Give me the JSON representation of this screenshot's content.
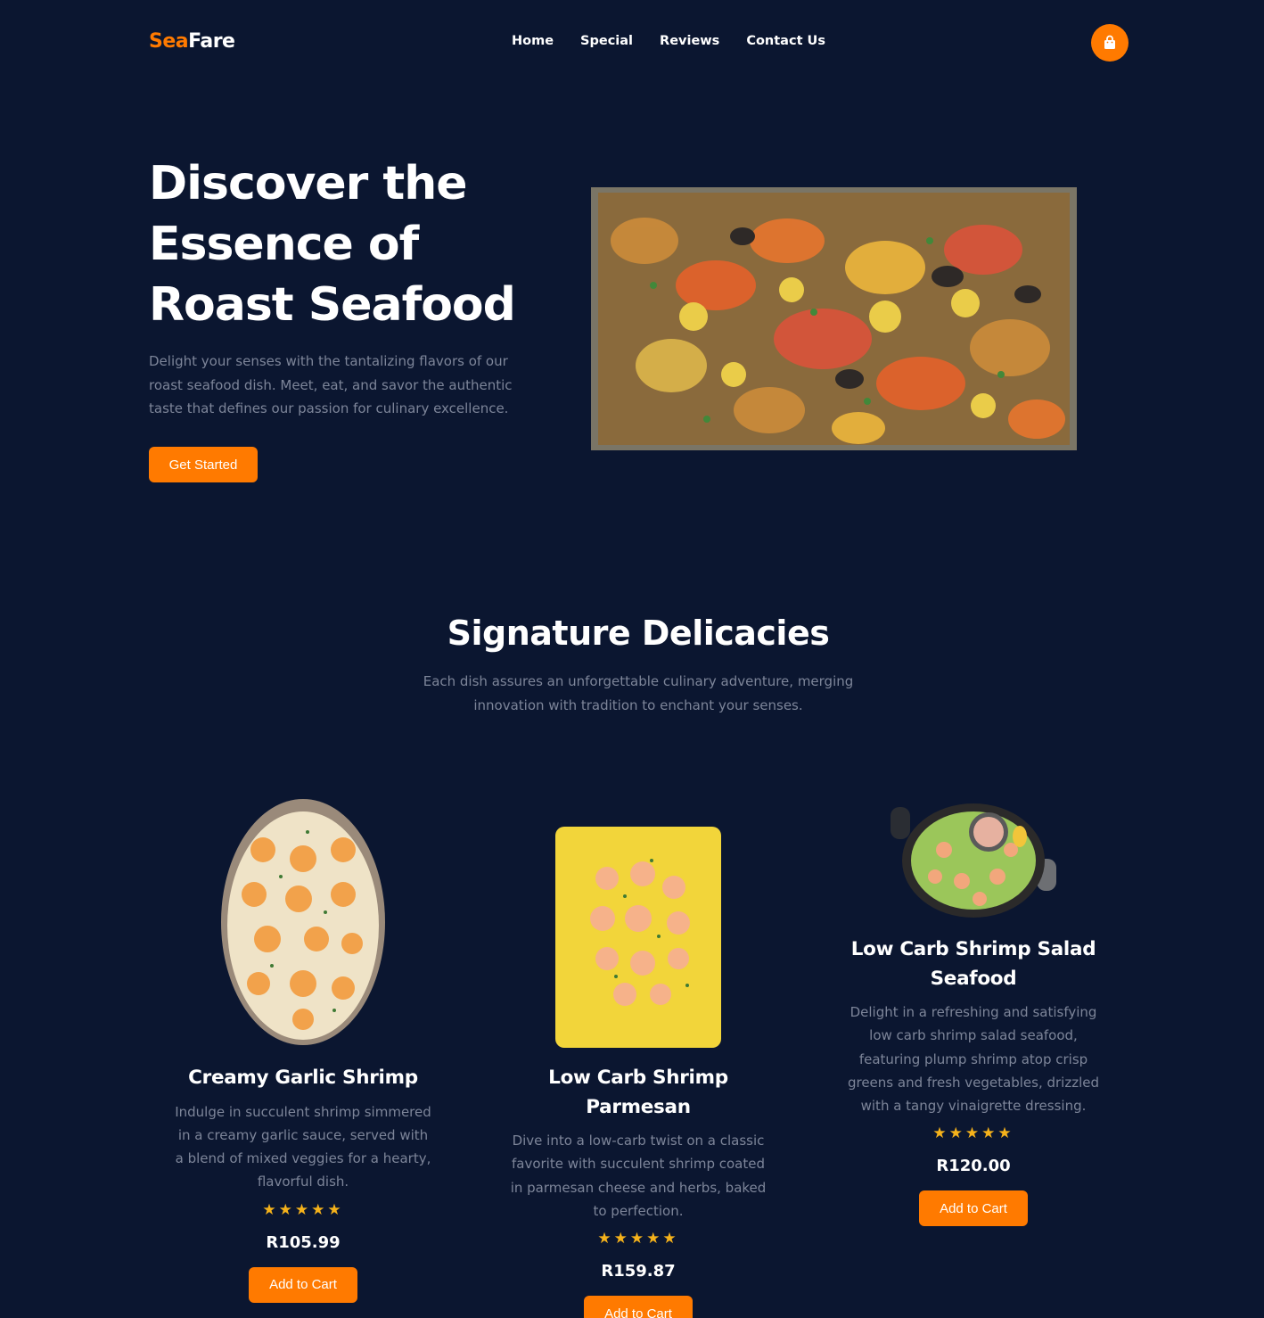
{
  "header": {
    "logo_part1": "Sea",
    "logo_part2": "Fare",
    "nav": [
      "Home",
      "Special",
      "Reviews",
      "Contact Us"
    ],
    "cart_icon": "shopping-bag-icon"
  },
  "hero": {
    "title": "Discover the Essence of Roast Seafood",
    "description": "Delight your senses with the tantalizing flavors of our roast seafood dish. Meet, eat, and savor the authentic taste that defines our passion for culinary excellence.",
    "cta": "Get Started"
  },
  "section": {
    "title": "Signature Delicacies",
    "subtitle": "Each dish assures an unforgettable culinary adventure, merging innovation with tradition to enchant your senses."
  },
  "cards": [
    {
      "title": "Creamy Garlic Shrimp",
      "description": "Indulge in succulent shrimp simmered in a creamy garlic sauce, served with a blend of mixed veggies for a hearty, flavorful dish.",
      "stars": "★★★★★",
      "rating": 5,
      "price": "R105.99",
      "button": "Add to Cart"
    },
    {
      "title": "Low Carb Shrimp Parmesan",
      "description": "Dive into a low-carb twist on a classic favorite with succulent shrimp coated in parmesan cheese and herbs, baked to perfection.",
      "stars": "★★★★★",
      "rating": 5,
      "price": "R159.87",
      "button": "Add to Cart"
    },
    {
      "title": "Low Carb Shrimp Salad Seafood",
      "description": "Delight in a refreshing and satisfying low carb shrimp salad seafood, featuring plump shrimp atop crisp greens and fresh vegetables, drizzled with a tangy vinaigrette dressing.",
      "stars": "★★★★★",
      "rating": 5,
      "price": "R120.00",
      "button": "Add to Cart"
    }
  ],
  "colors": {
    "background": "#0b1630",
    "accent": "#ff7a00",
    "muted_text": "#7d8599",
    "star": "#f5b21b"
  }
}
